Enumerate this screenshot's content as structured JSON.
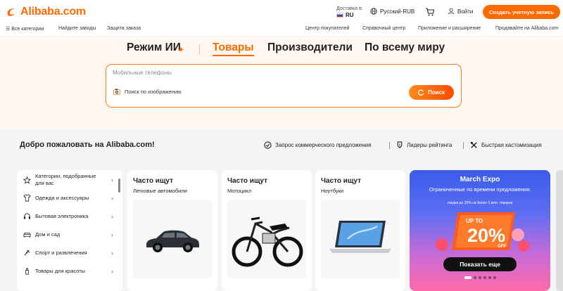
{
  "header": {
    "brand": "Alibaba.com",
    "delivery_label": "Доставка в:",
    "delivery_country": "RU",
    "language_currency": "Русский-RUB",
    "login": "Войти",
    "signup": "Создать учетную запись"
  },
  "nav": {
    "all_categories": "Все категории",
    "find_factories": "Найдите заводы",
    "order_protection": "Защита заказа",
    "buyer_center": "Центр покупателей",
    "help_center": "Справочный центр",
    "apps": "Приложение и расширение",
    "sell": "Продавайте на Alibaba.com"
  },
  "hero": {
    "tabs": [
      "Режим ИИ",
      "Товары",
      "Производители",
      "По всему миру"
    ],
    "active_tab": "Товары",
    "search_placeholder": "Мобильные телефоны",
    "image_search": "Поиск по изображению",
    "search_button": "Поиск"
  },
  "welcome": {
    "title": "Добро пожаловать на Alibaba.com!",
    "features": [
      "Запрос коммерческого предложения",
      "Лидеры рейтинга",
      "Быстрая кастомизация"
    ]
  },
  "categories": [
    {
      "label": "Категории, подобранные для вас",
      "icon": "star-icon"
    },
    {
      "label": "Одежда и аксессуары",
      "icon": "shirt-icon"
    },
    {
      "label": "Бытовая электроника",
      "icon": "headphones-icon"
    },
    {
      "label": "Дом и сад",
      "icon": "sofa-icon"
    },
    {
      "label": "Спорт и развлечения",
      "icon": "sport-icon"
    },
    {
      "label": "Товары для красоты",
      "icon": "beauty-icon"
    }
  ],
  "cards": [
    {
      "title": "Часто ищут",
      "subtitle": "Легковые автомобили",
      "image": "car-image"
    },
    {
      "title": "Часто ищут",
      "subtitle": "Мотоцикл",
      "image": "motorcycle-image"
    },
    {
      "title": "Часто ищут",
      "subtitle": "Ноутбуки",
      "image": "laptop-image"
    }
  ],
  "promo": {
    "brand": "March Expo",
    "offer": "Ограниченные по времени предложения:",
    "fine": "скидки до 20% на более 5 млн. товаров",
    "badge_up_to": "UP TO",
    "badge_percent": "20%",
    "badge_off": "OFF",
    "button": "Показать еще"
  },
  "colors": {
    "accent": "#ff6a00",
    "promo_start": "#3a5bea",
    "promo_end": "#ff6aa8"
  }
}
